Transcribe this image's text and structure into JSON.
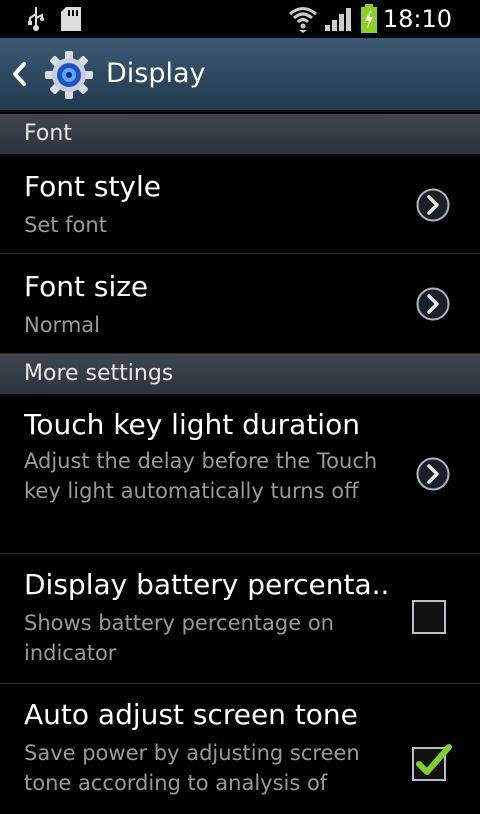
{
  "status_bar": {
    "time": "18:10",
    "icons": [
      "usb-icon",
      "sd-card-icon",
      "wifi-icon",
      "signal-icon",
      "battery-charging-icon"
    ],
    "battery_color": "#8fd11f"
  },
  "action_bar": {
    "title": "Display",
    "icon": "settings-gear-icon"
  },
  "sections": [
    {
      "header": "Font",
      "items": [
        {
          "title": "Font style",
          "summary": "Set font",
          "widget": "chevron"
        },
        {
          "title": "Font size",
          "summary": "Normal",
          "widget": "chevron"
        }
      ]
    },
    {
      "header": "More settings",
      "items": [
        {
          "title": "Touch key light duration",
          "summary": "Adjust the delay before the Touch key light automatically turns off",
          "widget": "chevron"
        },
        {
          "title": "Display battery percenta..",
          "summary": "Shows battery percentage on indicator",
          "widget": "checkbox",
          "checked": false
        },
        {
          "title": "Auto adjust screen tone",
          "summary": "Save power by adjusting screen tone according to analysis of",
          "widget": "checkbox",
          "checked": true
        }
      ]
    }
  ],
  "colors": {
    "accent_check": "#7ed321",
    "action_bar": "#2d4a62",
    "section_header": "#343b42"
  }
}
